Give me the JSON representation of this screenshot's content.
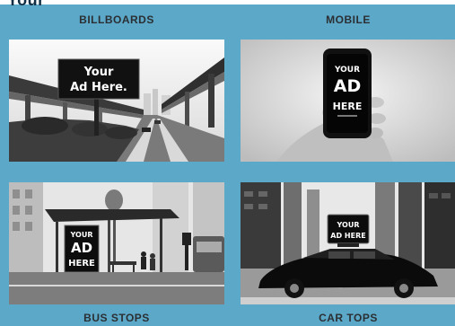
{
  "header": {
    "cropped_heading": "Your"
  },
  "panels": [
    {
      "label": "BILLBOARDS",
      "ad_lines": [
        "Your",
        "Ad Here."
      ]
    },
    {
      "label": "MOBILE",
      "ad_lines": [
        "YOUR",
        "AD",
        "HERE"
      ]
    },
    {
      "label": "BUS STOPS",
      "ad_lines": [
        "YOUR",
        "AD",
        "HERE"
      ]
    },
    {
      "label": "CAR TOPS",
      "ad_lines": [
        "YOUR",
        "AD HERE"
      ]
    }
  ],
  "colors": {
    "background": "#5ba8c8",
    "label_text": "#2b2f33"
  }
}
